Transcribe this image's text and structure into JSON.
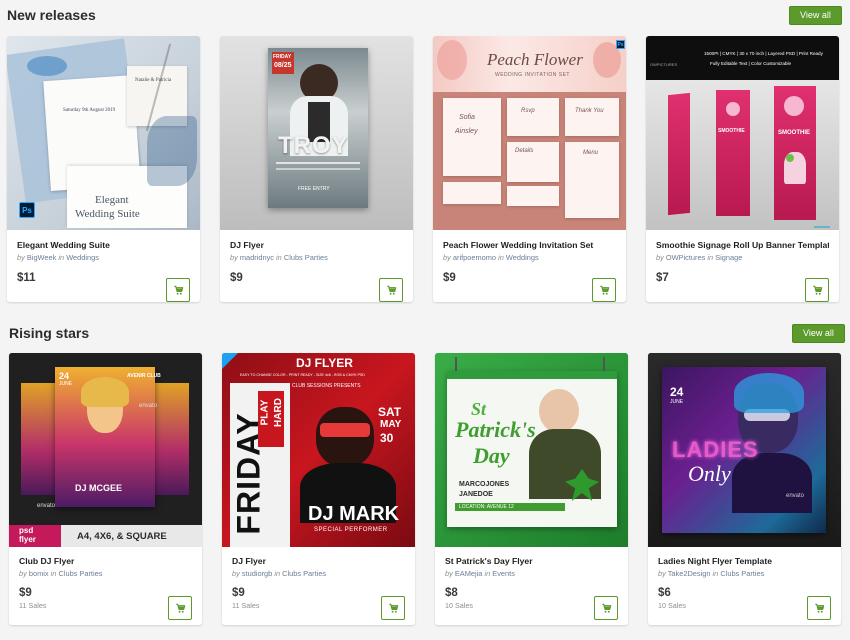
{
  "sections": {
    "new_releases": {
      "title": "New releases",
      "view_all": "View all",
      "items": [
        {
          "title": "Elegant Wedding Suite",
          "by": "by",
          "author": "BigWeek",
          "in": "in",
          "category": "Weddings",
          "price": "$11"
        },
        {
          "title": "DJ Flyer",
          "by": "by",
          "author": "madridnyc",
          "in": "in",
          "category": "Clubs Parties",
          "price": "$9"
        },
        {
          "title": "Peach Flower Wedding Invitation Set",
          "by": "by",
          "author": "arifpoemomo",
          "in": "in",
          "category": "Weddings",
          "price": "$9"
        },
        {
          "title": "Smoothie Signage Roll Up Banner Template",
          "by": "by",
          "author": "OWPictures",
          "in": "in",
          "category": "Signage",
          "price": "$7"
        }
      ]
    },
    "rising_stars": {
      "title": "Rising stars",
      "view_all": "View all",
      "items": [
        {
          "title": "Club DJ Flyer",
          "by": "by",
          "author": "bomix",
          "in": "in",
          "category": "Clubs Parties",
          "price": "$9",
          "sales": "11 Sales"
        },
        {
          "title": "DJ Flyer",
          "by": "by",
          "author": "studiorgb",
          "in": "in",
          "category": "Clubs Parties",
          "price": "$9",
          "sales": "11 Sales"
        },
        {
          "title": "St Patrick's Day Flyer",
          "by": "by",
          "author": "EAMejia",
          "in": "in",
          "category": "Events",
          "price": "$8",
          "sales": "10 Sales"
        },
        {
          "title": "Ladies Night Flyer Template",
          "by": "by",
          "author": "Take2Design",
          "in": "in",
          "category": "Clubs Parties",
          "price": "$6",
          "sales": "10 Sales"
        }
      ]
    }
  },
  "thumbs": {
    "wedding": {
      "line1": "Elegant",
      "line2": "Wedding Suite",
      "ps": "Ps",
      "invite": "Natalie & Patricia",
      "invite2": "Saturday 9th August 2019"
    },
    "djflyer": {
      "name": "TROY",
      "date": "08/25",
      "day": "FRIDAY",
      "bottom": "FREE ENTRY"
    },
    "peach": {
      "script": "Peach Flower",
      "sub": "WEDDING INVITATION SET",
      "ps": "Ps",
      "card1a": "Sofia",
      "card1b": "Ainsley",
      "card2": "Rsvp",
      "card3": "Thank You",
      "card4": "Details",
      "card5": "Menu"
    },
    "smoothie": {
      "header": "1500PI | CMYK | 30 x 70 inch | Layered PSD | Print Ready",
      "header2": "Fully Editable Text | Color Customizable",
      "brand": "OWPICTURES",
      "banner": "SMOOTHIE"
    },
    "clubdj": {
      "date1": "24",
      "month": "JUNE",
      "club": "AVENIR CLUB",
      "dj": "DJ MCGEE",
      "badge1": "psd",
      "badge2": "flyer",
      "sizes": "A4, 4X6, & SQUARE",
      "watermark": "envato"
    },
    "djflyer2": {
      "top": "DJ FLYER",
      "info": "EASY TO CHANGE COLOR - PRINT READY - SIZE 4x6 - RGB & CMYK PSD",
      "friday": "FRIDAY",
      "play": "PLAY",
      "hard": "HARD",
      "sat": "SAT",
      "may": "MAY",
      "num": "30",
      "djmark": "DJ MARK",
      "special": "SPECIAL PERFORMER",
      "presents": "CLUB SESSIONS PRESENTS"
    },
    "patrick": {
      "st": "St",
      "patrick": "Patrick's",
      "day": "Day",
      "dj1": "MARCOJONES",
      "dj2": "JANEDOE",
      "footer": "LOCATION: AVENUE 12"
    },
    "ladies": {
      "num": "24",
      "month": "JUNE",
      "ladies": "LADIES",
      "only": "Only",
      "watermark": "envato"
    }
  },
  "colors": {
    "accent": "#5b9a2b",
    "link": "#6a7f96"
  }
}
